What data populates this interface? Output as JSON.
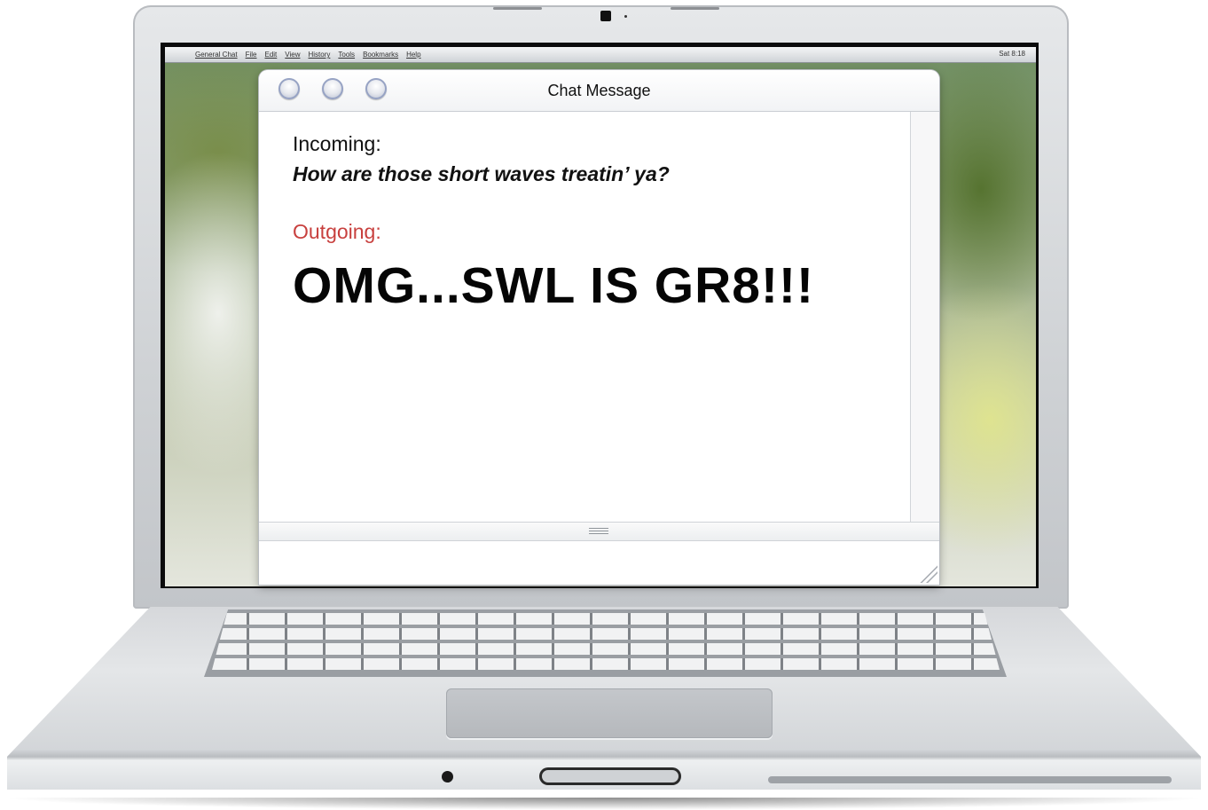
{
  "menubar": {
    "items": [
      "General Chat",
      "File",
      "Edit",
      "View",
      "History",
      "Tools",
      "Bookmarks",
      "Help"
    ],
    "clock": "Sat 8:18"
  },
  "window": {
    "title": "Chat Message",
    "traffic_lights": [
      "close-button",
      "minimize-button",
      "maximize-button"
    ]
  },
  "conversation": {
    "incoming_label": "Incoming:",
    "incoming_text": "How are those short waves treatin’ ya?",
    "outgoing_label": "Outgoing:",
    "outgoing_text": "OMG...SWL IS GR8!!!"
  },
  "colors": {
    "outgoing_label": "#c8403e",
    "traffic_light": "#97a3c4"
  }
}
